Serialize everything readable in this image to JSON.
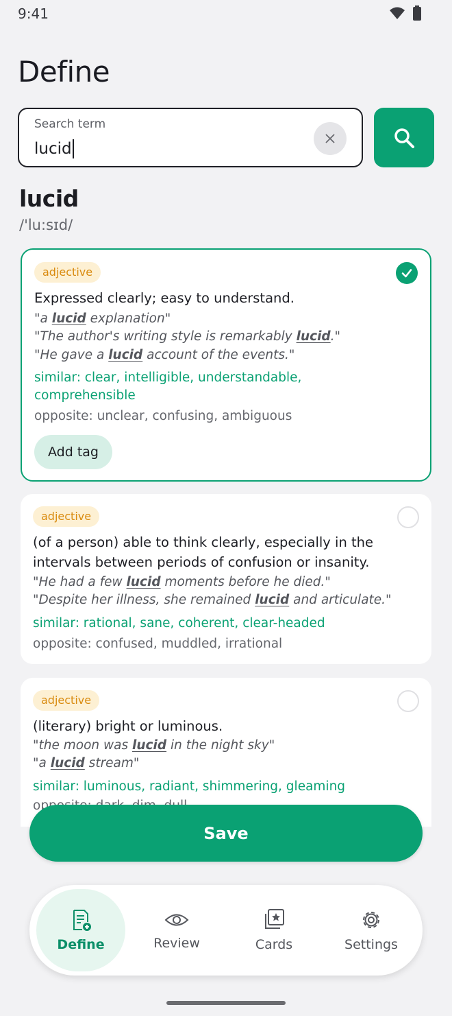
{
  "status": {
    "time": "9:41"
  },
  "page": {
    "title": "Define"
  },
  "search": {
    "label": "Search term",
    "value": "lucid"
  },
  "word": {
    "text": "lucid",
    "phonetic": "/'lu:sɪd/"
  },
  "senses": [
    {
      "pos": "adjective",
      "selected": true,
      "definition": "Expressed clearly; easy to understand.",
      "examples": [
        [
          "\"a ",
          "lucid",
          " explanation\""
        ],
        [
          "\"The author's writing style is remarkably ",
          "lucid",
          ".\""
        ],
        [
          "\"He gave a ",
          "lucid",
          " account of the events.\""
        ]
      ],
      "similar": "similar: clear, intelligible, understandable, comprehensible",
      "opposite": "opposite: unclear, confusing, ambiguous",
      "tag_label": "Add tag"
    },
    {
      "pos": "adjective",
      "selected": false,
      "definition": "(of a person) able to think clearly, especially in the intervals between periods of confusion or insanity.",
      "examples": [
        [
          "\"He had a few ",
          "lucid",
          " moments before he died.\""
        ],
        [
          "\"Despite her illness, she remained ",
          "lucid",
          " and articulate.\""
        ]
      ],
      "similar": "similar: rational, sane, coherent, clear-headed",
      "opposite": "opposite: confused, muddled, irrational"
    },
    {
      "pos": "adjective",
      "selected": false,
      "definition": "(literary) bright or luminous.",
      "examples": [
        [
          "\"the moon was ",
          "lucid",
          " in the night sky\""
        ],
        [
          "\"a ",
          "lucid",
          " stream\""
        ]
      ],
      "similar": "similar: luminous, radiant, shimmering, gleaming",
      "opposite": "opposite: dark, dim, dull"
    }
  ],
  "actions": {
    "save_label": "Save"
  },
  "nav": {
    "items": [
      {
        "label": "Define",
        "icon": "define-icon",
        "active": true
      },
      {
        "label": "Review",
        "icon": "eye-icon",
        "active": false
      },
      {
        "label": "Cards",
        "icon": "cards-icon",
        "active": false
      },
      {
        "label": "Settings",
        "icon": "gear-icon",
        "active": false
      }
    ]
  },
  "colors": {
    "accent": "#0aa173",
    "chip_bg": "#fdf0d3",
    "chip_text": "#d98a0e"
  }
}
